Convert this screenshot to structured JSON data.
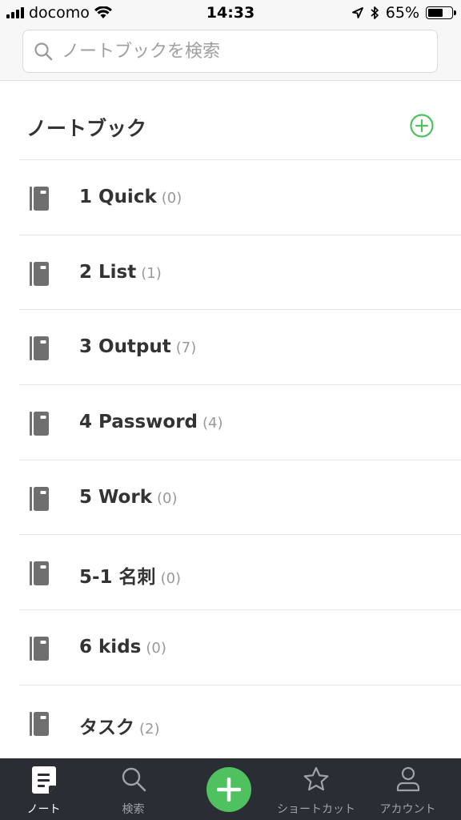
{
  "status_bar": {
    "carrier": "docomo",
    "time": "14:33",
    "battery_text": "65%",
    "battery_level": 0.65
  },
  "search": {
    "placeholder": "ノートブックを検索"
  },
  "section": {
    "title": "ノートブック"
  },
  "notebooks": [
    {
      "name": "1 Quick",
      "count": "(0)"
    },
    {
      "name": "2 List",
      "count": "(1)"
    },
    {
      "name": "3 Output",
      "count": "(7)"
    },
    {
      "name": "4 Password",
      "count": "(4)"
    },
    {
      "name": "5 Work",
      "count": "(0)"
    },
    {
      "name": "5-1 名刺",
      "count": "(0)"
    },
    {
      "name": "6 kids",
      "count": "(0)"
    },
    {
      "name": "タスク",
      "count": "(2)"
    }
  ],
  "tabbar": {
    "tabs": [
      {
        "label": "ノート",
        "icon": "note-icon",
        "active": true
      },
      {
        "label": "検索",
        "icon": "search-icon",
        "active": false
      },
      {
        "label": "ショートカット",
        "icon": "star-icon",
        "active": false
      },
      {
        "label": "アカウント",
        "icon": "person-icon",
        "active": false
      }
    ]
  },
  "colors": {
    "accent": "#4fc15f",
    "tabbar_bg": "#2a2d33",
    "text": "#333333",
    "muted": "#999999"
  }
}
